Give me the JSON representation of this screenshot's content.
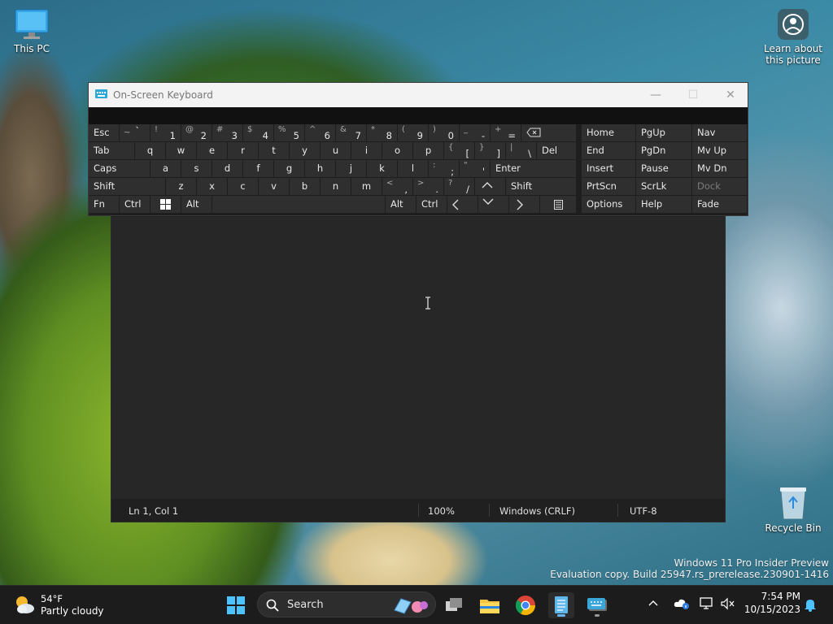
{
  "desktop": {
    "icons": [
      {
        "label": "This PC"
      },
      {
        "label": "Recycle Bin"
      }
    ],
    "learn_about": "Learn about this picture",
    "watermark": {
      "line1": "Windows 11 Pro Insider Preview",
      "line2": "Evaluation copy. Build 25947.rs_prerelease.230901-1416"
    }
  },
  "osk": {
    "title": "On-Screen Keyboard",
    "controls": {
      "minimize": "—",
      "maximize": "☐",
      "close": "✕"
    },
    "keys": {
      "esc": "Esc",
      "tab": "Tab",
      "caps": "Caps",
      "shift": "Shift",
      "fn": "Fn",
      "ctrl": "Ctrl",
      "alt": "Alt",
      "del": "Del",
      "enter": "Enter",
      "home": "Home",
      "pgup": "PgUp",
      "nav": "Nav",
      "end": "End",
      "pgdn": "PgDn",
      "mvup": "Mv Up",
      "insert": "Insert",
      "pause": "Pause",
      "mvdn": "Mv Dn",
      "prtscn": "PrtScn",
      "scrlk": "ScrLk",
      "dock": "Dock",
      "options": "Options",
      "help": "Help",
      "fade": "Fade",
      "row1": [
        {
          "s": "~",
          "p": "`"
        },
        {
          "s": "!",
          "p": "1"
        },
        {
          "s": "@",
          "p": "2"
        },
        {
          "s": "#",
          "p": "3"
        },
        {
          "s": "$",
          "p": "4"
        },
        {
          "s": "%",
          "p": "5"
        },
        {
          "s": "^",
          "p": "6"
        },
        {
          "s": "&",
          "p": "7"
        },
        {
          "s": "*",
          "p": "8"
        },
        {
          "s": "(",
          "p": "9"
        },
        {
          "s": ")",
          "p": "0"
        },
        {
          "s": "_",
          "p": "-"
        },
        {
          "s": "+",
          "p": "="
        }
      ],
      "row2": [
        "q",
        "w",
        "e",
        "r",
        "t",
        "y",
        "u",
        "i",
        "o",
        "p"
      ],
      "row2_sym": [
        {
          "s": "{",
          "p": "["
        },
        {
          "s": "}",
          "p": "]"
        },
        {
          "s": "|",
          "p": "\\"
        }
      ],
      "row3": [
        "a",
        "s",
        "d",
        "f",
        "g",
        "h",
        "j",
        "k",
        "l"
      ],
      "row3_sym": [
        {
          "s": ":",
          "p": ";"
        },
        {
          "s": "\"",
          "p": "'"
        }
      ],
      "row4": [
        "z",
        "x",
        "c",
        "v",
        "b",
        "n",
        "m"
      ],
      "row4_sym": [
        {
          "s": "<",
          "p": ","
        },
        {
          "s": ">",
          "p": "."
        },
        {
          "s": "?",
          "p": "/"
        }
      ]
    }
  },
  "notepad": {
    "status": {
      "position": "Ln 1, Col 1",
      "zoom": "100%",
      "line_ending": "Windows (CRLF)",
      "encoding": "UTF-8"
    }
  },
  "taskbar": {
    "weather": {
      "temp": "54°F",
      "desc": "Partly cloudy"
    },
    "search_label": "Search",
    "time": "7:54 PM",
    "date": "10/15/2023"
  }
}
